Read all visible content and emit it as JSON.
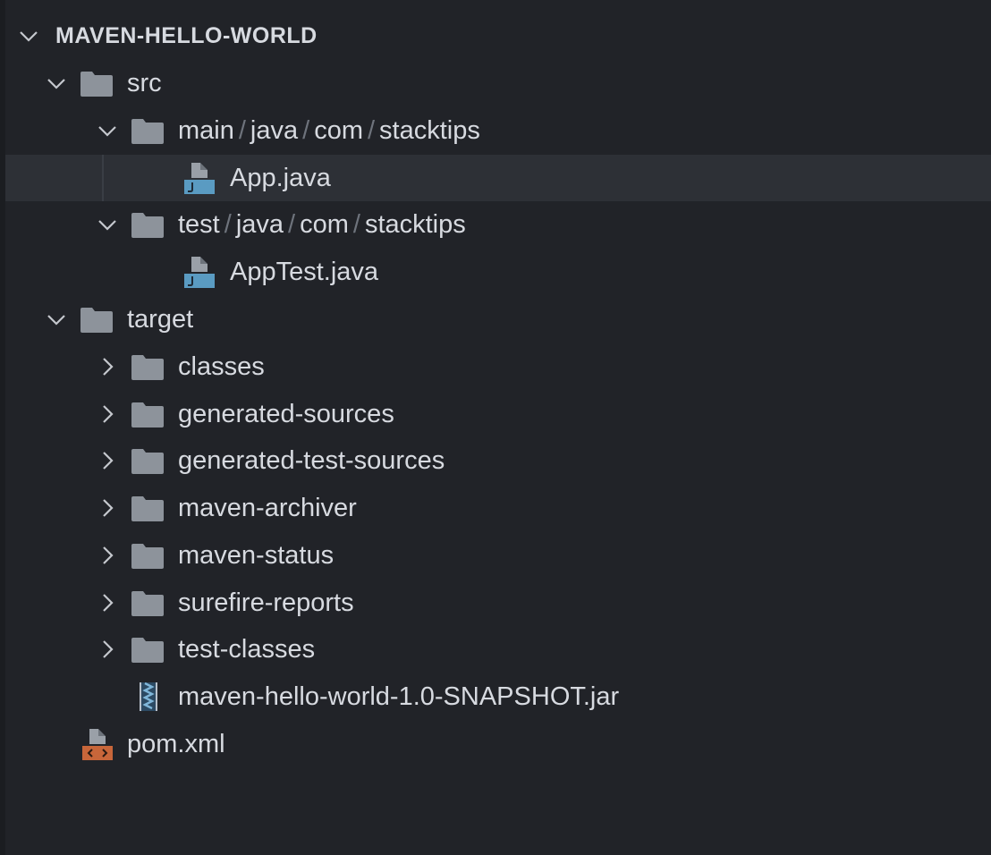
{
  "explorer": {
    "root": "MAVEN-HELLO-WORLD",
    "src": "src",
    "main_path": [
      "main",
      "java",
      "com",
      "stacktips"
    ],
    "app_java": "App.java",
    "test_path": [
      "test",
      "java",
      "com",
      "stacktips"
    ],
    "apptest_java": "AppTest.java",
    "target": "target",
    "target_children": [
      "classes",
      "generated-sources",
      "generated-test-sources",
      "maven-archiver",
      "maven-status",
      "surefire-reports",
      "test-classes"
    ],
    "jar": "maven-hello-world-1.0-SNAPSHOT.jar",
    "pom": "pom.xml",
    "path_separator": "/"
  },
  "colors": {
    "background": "#212328",
    "selected_row": "#2d3036",
    "text": "#d7dae0",
    "folder_icon": "#8d939b",
    "java_icon": "#5a9bc2",
    "xml_icon": "#c8663a"
  },
  "icons": {
    "folder": "folder-icon",
    "java": "java-file-icon",
    "jar": "jar-archive-icon",
    "xml": "xml-file-icon",
    "expanded": "chevron-down-icon",
    "collapsed": "chevron-right-icon"
  }
}
